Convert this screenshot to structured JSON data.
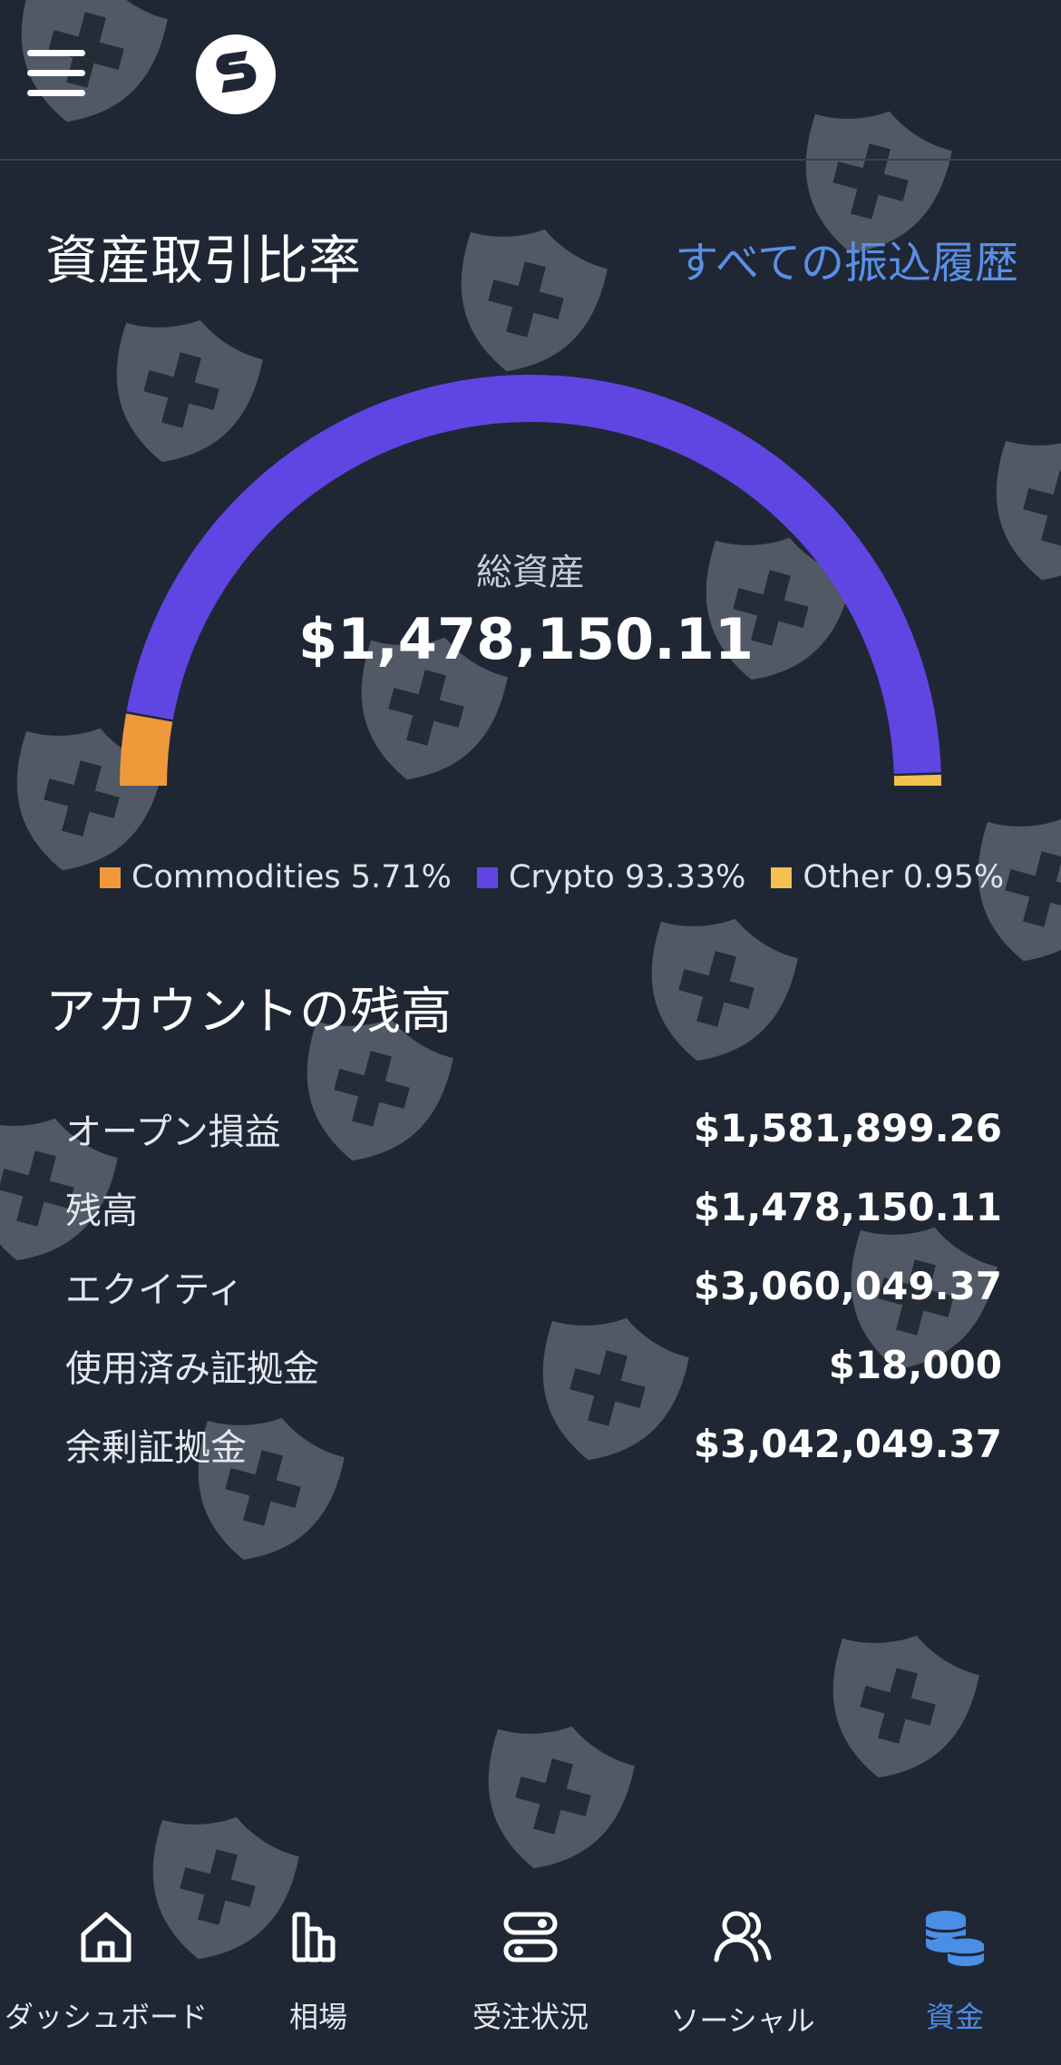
{
  "header": {
    "menu_icon": "hamburger-icon",
    "logo_icon": "app-logo-icon"
  },
  "asset_section": {
    "title": "資産取引比率",
    "all_transfers_link": "すべての振込履歴",
    "total_label": "総資産",
    "total_value": "$1,478,150.11"
  },
  "chart_data": {
    "type": "pie",
    "style": "semi-donut gauge",
    "slices": [
      {
        "name": "Commodities",
        "percent": 5.71,
        "color": "#f0993a"
      },
      {
        "name": "Crypto",
        "percent": 93.33,
        "color": "#5f46e3"
      },
      {
        "name": "Other",
        "percent": 0.95,
        "color": "#f2c14e"
      }
    ]
  },
  "legend": [
    {
      "label": "Commodities 5.71%",
      "color": "#f0993a"
    },
    {
      "label": "Crypto 93.33%",
      "color": "#5f46e3"
    },
    {
      "label": "Other 0.95%",
      "color": "#f2c14e"
    }
  ],
  "account": {
    "title": "アカウントの残高",
    "rows": [
      {
        "label": "オープン損益",
        "value": "$1,581,899.26"
      },
      {
        "label": "残高",
        "value": "$1,478,150.11"
      },
      {
        "label": "エクイティ",
        "value": "$3,060,049.37"
      },
      {
        "label": "使用済み証拠金",
        "value": "$18,000"
      },
      {
        "label": "余剰証拠金",
        "value": "$3,042,049.37"
      }
    ]
  },
  "tabs": [
    {
      "label": "ダッシュボード",
      "icon": "home-icon"
    },
    {
      "label": "相場",
      "icon": "bar-chart-icon"
    },
    {
      "label": "受注状況",
      "icon": "toggle-orders-icon"
    },
    {
      "label": "ソーシャル",
      "icon": "users-icon"
    },
    {
      "label": "資金",
      "icon": "coins-icon",
      "active": true
    }
  ],
  "colors": {
    "background": "#1f2735",
    "link": "#5a8fe5",
    "active_tab": "#4a8ee6",
    "watermark": "#5b6270"
  }
}
